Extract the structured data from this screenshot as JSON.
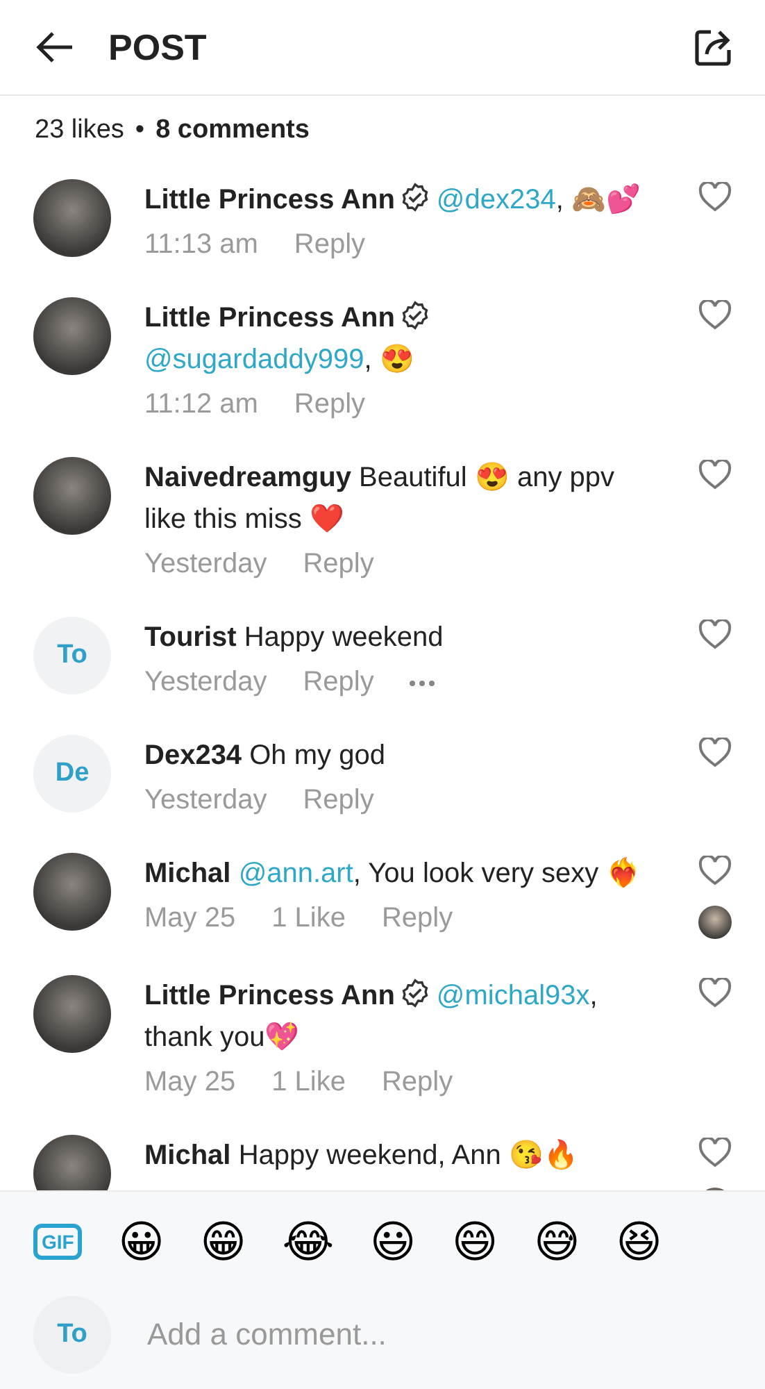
{
  "header": {
    "title": "POST"
  },
  "summary": {
    "likes": "23 likes",
    "separator": "•",
    "comments": "8 comments"
  },
  "comments": [
    {
      "avatar": {
        "kind": "photo"
      },
      "name": "Little Princess Ann",
      "verified": true,
      "body": [
        {
          "kind": "mention",
          "text": "@dex234"
        },
        {
          "kind": "text",
          "text": ", 🙈💕"
        }
      ],
      "time": "11:13 am",
      "reply": "Reply",
      "liked": false,
      "has_more_menu": false,
      "liked_by_author": false
    },
    {
      "avatar": {
        "kind": "photo"
      },
      "name": "Little Princess Ann",
      "verified": true,
      "body": [
        {
          "kind": "mention",
          "text": "@sugardaddy999"
        },
        {
          "kind": "text",
          "text": ", 😍"
        }
      ],
      "time": "11:12 am",
      "reply": "Reply",
      "liked": false,
      "has_more_menu": false,
      "liked_by_author": false
    },
    {
      "avatar": {
        "kind": "photo"
      },
      "name": "Naivedreamguy",
      "verified": false,
      "body": [
        {
          "kind": "text",
          "text": "Beautiful 😍 any ppv like this miss ❤️"
        }
      ],
      "time": "Yesterday",
      "reply": "Reply",
      "liked": false,
      "has_more_menu": false,
      "liked_by_author": false
    },
    {
      "avatar": {
        "kind": "initials",
        "text": "To"
      },
      "name": "Tourist",
      "verified": false,
      "body": [
        {
          "kind": "text",
          "text": "Happy weekend"
        }
      ],
      "time": "Yesterday",
      "reply": "Reply",
      "liked": false,
      "has_more_menu": true,
      "liked_by_author": false
    },
    {
      "avatar": {
        "kind": "initials",
        "text": "De"
      },
      "name": "Dex234",
      "verified": false,
      "body": [
        {
          "kind": "text",
          "text": "Oh my god"
        }
      ],
      "time": "Yesterday",
      "reply": "Reply",
      "liked": false,
      "has_more_menu": false,
      "liked_by_author": false
    },
    {
      "avatar": {
        "kind": "photo"
      },
      "name": "Michal",
      "verified": false,
      "body": [
        {
          "kind": "mention",
          "text": "@ann.art"
        },
        {
          "kind": "text",
          "text": ", You look very sexy ❤️‍🔥"
        }
      ],
      "time": "May 25",
      "likes": "1 Like",
      "reply": "Reply",
      "liked": false,
      "has_more_menu": false,
      "liked_by_author": true
    },
    {
      "avatar": {
        "kind": "photo"
      },
      "name": "Little Princess Ann",
      "verified": true,
      "body": [
        {
          "kind": "mention",
          "text": "@michal93x"
        },
        {
          "kind": "text",
          "text": ", thank you💖"
        }
      ],
      "time": "May 25",
      "likes": "1 Like",
      "reply": "Reply",
      "liked": false,
      "has_more_menu": false,
      "liked_by_author": false
    },
    {
      "avatar": {
        "kind": "photo"
      },
      "name": "Michal",
      "verified": false,
      "body": [
        {
          "kind": "text",
          "text": "Happy weekend, Ann 😘🔥"
        }
      ],
      "liked": false,
      "has_more_menu": false,
      "liked_by_author": true
    }
  ],
  "composer": {
    "gif": "GIF",
    "emojis": [
      "😀",
      "😁",
      "😂",
      "😃",
      "😄",
      "😅",
      "😆"
    ],
    "avatar": "To",
    "placeholder": "Add a comment..."
  }
}
